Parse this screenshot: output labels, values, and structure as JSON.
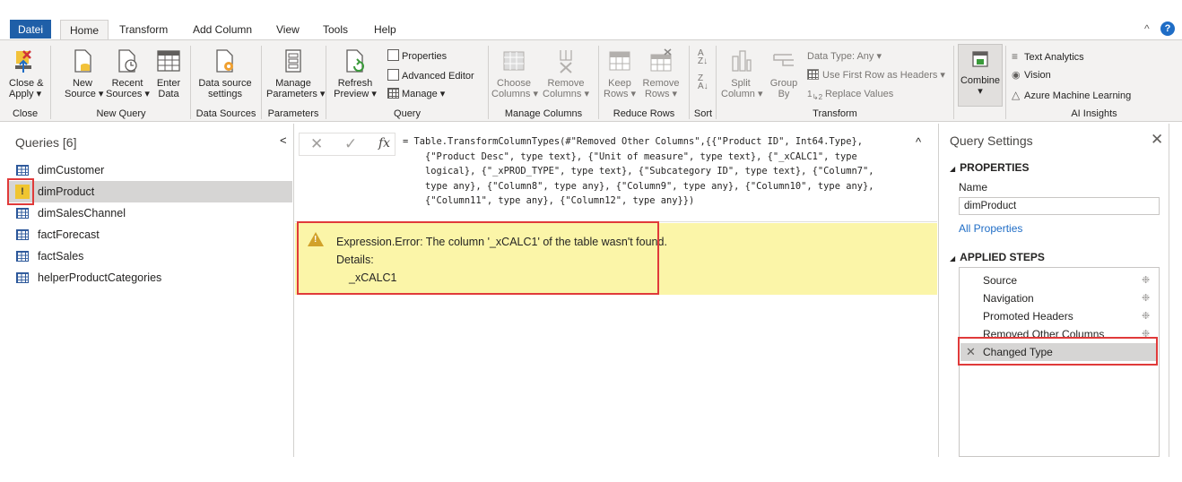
{
  "tabs": {
    "file": "Datei",
    "home": "Home",
    "transform": "Transform",
    "add_column": "Add Column",
    "view": "View",
    "tools": "Tools",
    "help": "Help"
  },
  "window": {
    "help_icon": "?",
    "collapse_icon": "chevron-up-icon"
  },
  "ribbon": {
    "close_apply": [
      "Close &",
      "Apply ▾"
    ],
    "new_source": [
      "New",
      "Source ▾"
    ],
    "recent_sources": [
      "Recent",
      "Sources ▾"
    ],
    "enter_data": [
      "Enter",
      "Data"
    ],
    "data_source_settings": [
      "Data source",
      "settings"
    ],
    "manage_parameters": [
      "Manage",
      "Parameters ▾"
    ],
    "refresh_preview": [
      "Refresh",
      "Preview ▾"
    ],
    "properties": "Properties",
    "advanced_editor": "Advanced Editor",
    "manage": "Manage ▾",
    "choose_columns": [
      "Choose",
      "Columns ▾"
    ],
    "remove_columns": [
      "Remove",
      "Columns ▾"
    ],
    "keep_rows": [
      "Keep",
      "Rows ▾"
    ],
    "remove_rows": [
      "Remove",
      "Rows ▾"
    ],
    "split_column": [
      "Split",
      "Column ▾"
    ],
    "group_by": [
      "Group",
      "By"
    ],
    "data_type": "Data Type: Any ▾",
    "first_row_headers": "Use First Row as Headers ▾",
    "replace_values": "Replace Values",
    "combine": [
      "Combine",
      "▾"
    ],
    "text_analytics": "Text Analytics",
    "vision": "Vision",
    "azure_ml": "Azure Machine Learning",
    "groups": {
      "close": "Close",
      "new_query": "New Query",
      "data_sources": "Data Sources",
      "parameters": "Parameters",
      "query": "Query",
      "manage_columns": "Manage Columns",
      "reduce_rows": "Reduce Rows",
      "sort": "Sort",
      "transform": "Transform",
      "ai_insights": "AI Insights"
    }
  },
  "queries_pane": {
    "title": "Queries [6]",
    "collapse": "<",
    "items": [
      {
        "name": "dimCustomer",
        "icon": "table-icon"
      },
      {
        "name": "dimProduct",
        "icon": "warning-icon",
        "selected": true
      },
      {
        "name": "dimSalesChannel",
        "icon": "table-icon"
      },
      {
        "name": "factForecast",
        "icon": "table-icon"
      },
      {
        "name": "factSales",
        "icon": "table-icon"
      },
      {
        "name": "helperProductCategories",
        "icon": "table-icon"
      }
    ]
  },
  "formula_bar": {
    "fx": "fx",
    "lines": [
      "= Table.TransformColumnTypes(#\"Removed Other Columns\",{{\"Product ID\", Int64.Type},",
      "    {\"Product Desc\", type text}, {\"Unit of measure\", type text}, {\"_xCALC1\", type",
      "    logical}, {\"_xPROD_TYPE\", type text}, {\"Subcategory ID\", type text}, {\"Column7\",",
      "    type any}, {\"Column8\", type any}, {\"Column9\", type any}, {\"Column10\", type any},",
      "    {\"Column11\", type any}, {\"Column12\", type any}})"
    ]
  },
  "error": {
    "message": "Expression.Error: The column '_xCALC1' of the table wasn't found.",
    "details_label": "Details:",
    "details_value": "_xCALC1"
  },
  "settings_pane": {
    "title": "Query Settings",
    "close": "✕",
    "properties_header": "PROPERTIES",
    "name_label": "Name",
    "name_value": "dimProduct",
    "all_properties": "All Properties",
    "steps_header": "APPLIED STEPS",
    "steps": [
      {
        "name": "Source"
      },
      {
        "name": "Navigation"
      },
      {
        "name": "Promoted Headers"
      },
      {
        "name": "Removed Other Columns"
      },
      {
        "name": "Changed Type",
        "selected": true
      }
    ]
  },
  "colors": {
    "file_tab": "#1f5fa8",
    "ribbon_bg": "#f3f2f1",
    "error_bg": "#fbf5a8",
    "highlight_red": "#e03a3a",
    "warning_yellow": "#f0c530",
    "link_blue": "#1f6dc6"
  }
}
